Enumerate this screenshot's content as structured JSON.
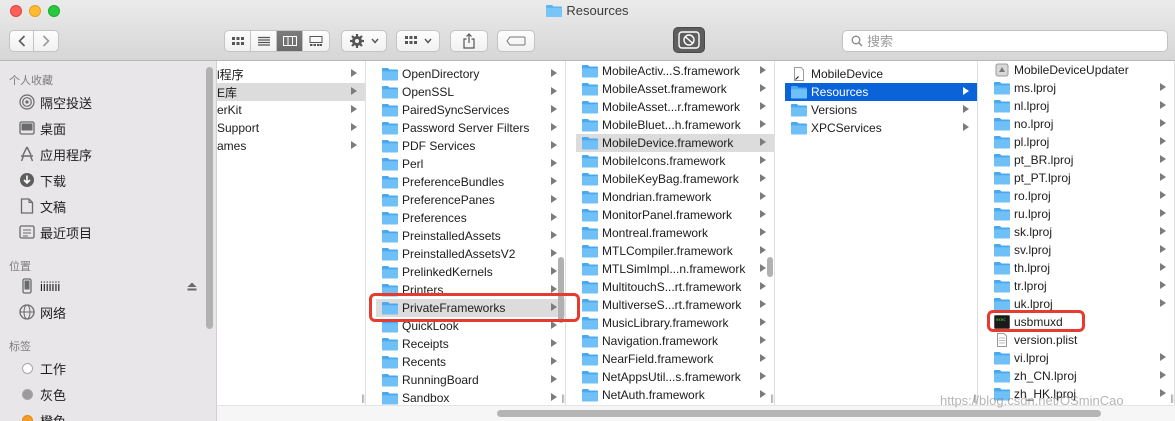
{
  "window": {
    "title": "Resources"
  },
  "toolbar": {
    "back_icon": "chevron-left-icon",
    "forward_icon": "chevron-right-icon",
    "view_modes": [
      "icon-view",
      "list-view",
      "column-view",
      "gallery-view"
    ],
    "active_view": "column-view",
    "action_icon": "gear-icon",
    "group_icon": "grid-group-icon",
    "share_icon": "share-icon",
    "tag_icon": "tag-icon",
    "search_placeholder": "搜索"
  },
  "sidebar": {
    "favorites_header": "个人收藏",
    "favorites": [
      {
        "label": "隔空投送",
        "icon": "airdrop-icon"
      },
      {
        "label": "桌面",
        "icon": "desktop-icon"
      },
      {
        "label": "应用程序",
        "icon": "applications-icon"
      },
      {
        "label": "下载",
        "icon": "download-icon"
      },
      {
        "label": "文稿",
        "icon": "documents-icon"
      },
      {
        "label": "最近项目",
        "icon": "recents-icon"
      }
    ],
    "locations_header": "位置",
    "locations": [
      {
        "label": "iiiiiii",
        "icon": "device-icon"
      },
      {
        "label": "网络",
        "icon": "network-icon"
      }
    ],
    "tags_header": "标签",
    "tags": [
      {
        "label": "工作",
        "color": "#ffffff"
      },
      {
        "label": "灰色",
        "color": "#9b9b9b"
      },
      {
        "label": "橙色",
        "color": "#f39c28"
      }
    ]
  },
  "columns": [
    {
      "items": [
        {
          "label": "l程序",
          "arrow": true
        },
        {
          "label": "E库",
          "arrow": true,
          "selected": "gray"
        },
        {
          "label": "erKit",
          "arrow": true
        },
        {
          "label": "Support",
          "arrow": true
        },
        {
          "label": "ames",
          "arrow": true
        }
      ]
    },
    {
      "items": [
        {
          "label": "OpenDirectory",
          "arrow": true
        },
        {
          "label": "OpenSSL",
          "arrow": true
        },
        {
          "label": "PairedSyncServices",
          "arrow": true
        },
        {
          "label": "Password Server Filters",
          "arrow": true
        },
        {
          "label": "PDF Services",
          "arrow": true
        },
        {
          "label": "Perl",
          "arrow": true
        },
        {
          "label": "PreferenceBundles",
          "arrow": true
        },
        {
          "label": "PreferencePanes",
          "arrow": true
        },
        {
          "label": "Preferences",
          "arrow": true
        },
        {
          "label": "PreinstalledAssets",
          "arrow": true
        },
        {
          "label": "PreinstalledAssetsV2",
          "arrow": true
        },
        {
          "label": "PrelinkedKernels",
          "arrow": true
        },
        {
          "label": "Printers",
          "arrow": true
        },
        {
          "label": "PrivateFrameworks",
          "arrow": true,
          "selected": "gray"
        },
        {
          "label": "QuickLook",
          "arrow": true
        },
        {
          "label": "Receipts",
          "arrow": true
        },
        {
          "label": "Recents",
          "arrow": true
        },
        {
          "label": "RunningBoard",
          "arrow": true
        },
        {
          "label": "Sandbox",
          "arrow": true
        }
      ]
    },
    {
      "items": [
        {
          "label": "MobileActiv...S.framework",
          "arrow": true
        },
        {
          "label": "MobileAsset.framework",
          "arrow": true
        },
        {
          "label": "MobileAsset...r.framework",
          "arrow": true
        },
        {
          "label": "MobileBluet...h.framework",
          "arrow": true
        },
        {
          "label": "MobileDevice.framework",
          "arrow": true,
          "selected": "gray"
        },
        {
          "label": "MobileIcons.framework",
          "arrow": true
        },
        {
          "label": "MobileKeyBag.framework",
          "arrow": true
        },
        {
          "label": "Mondrian.framework",
          "arrow": true
        },
        {
          "label": "MonitorPanel.framework",
          "arrow": true
        },
        {
          "label": "Montreal.framework",
          "arrow": true
        },
        {
          "label": "MTLCompiler.framework",
          "arrow": true
        },
        {
          "label": "MTLSimImpl...n.framework",
          "arrow": true
        },
        {
          "label": "MultitouchS...rt.framework",
          "arrow": true
        },
        {
          "label": "MultiverseS...rt.framework",
          "arrow": true
        },
        {
          "label": "MusicLibrary.framework",
          "arrow": true
        },
        {
          "label": "Navigation.framework",
          "arrow": true
        },
        {
          "label": "NearField.framework",
          "arrow": true
        },
        {
          "label": "NetAppsUtil...s.framework",
          "arrow": true
        },
        {
          "label": "NetAuth.framework",
          "arrow": true
        }
      ]
    },
    {
      "items": [
        {
          "label": "MobileDevice",
          "arrow": false,
          "icon": "alias-doc-icon"
        },
        {
          "label": "Resources",
          "arrow": true,
          "selected": "blue"
        },
        {
          "label": "Versions",
          "arrow": true
        },
        {
          "label": "XPCServices",
          "arrow": true
        }
      ]
    },
    {
      "items": [
        {
          "label": "MobileDeviceUpdater",
          "arrow": false,
          "icon": "app-icon"
        },
        {
          "label": "ms.lproj",
          "arrow": true
        },
        {
          "label": "nl.lproj",
          "arrow": true
        },
        {
          "label": "no.lproj",
          "arrow": true
        },
        {
          "label": "pl.lproj",
          "arrow": true
        },
        {
          "label": "pt_BR.lproj",
          "arrow": true
        },
        {
          "label": "pt_PT.lproj",
          "arrow": true
        },
        {
          "label": "ro.lproj",
          "arrow": true
        },
        {
          "label": "ru.lproj",
          "arrow": true
        },
        {
          "label": "sk.lproj",
          "arrow": true
        },
        {
          "label": "sv.lproj",
          "arrow": true
        },
        {
          "label": "th.lproj",
          "arrow": true
        },
        {
          "label": "tr.lproj",
          "arrow": true
        },
        {
          "label": "uk.lproj",
          "arrow": true
        },
        {
          "label": "usbmuxd",
          "arrow": false,
          "icon": "terminal-exec-icon"
        },
        {
          "label": "version.plist",
          "arrow": false,
          "icon": "plist-doc-icon"
        },
        {
          "label": "vi.lproj",
          "arrow": true
        },
        {
          "label": "zh_CN.lproj",
          "arrow": true
        },
        {
          "label": "zh_HK.lproj",
          "arrow": true
        }
      ]
    }
  ],
  "watermark": "https://blog.csdn.net/OSminCao"
}
